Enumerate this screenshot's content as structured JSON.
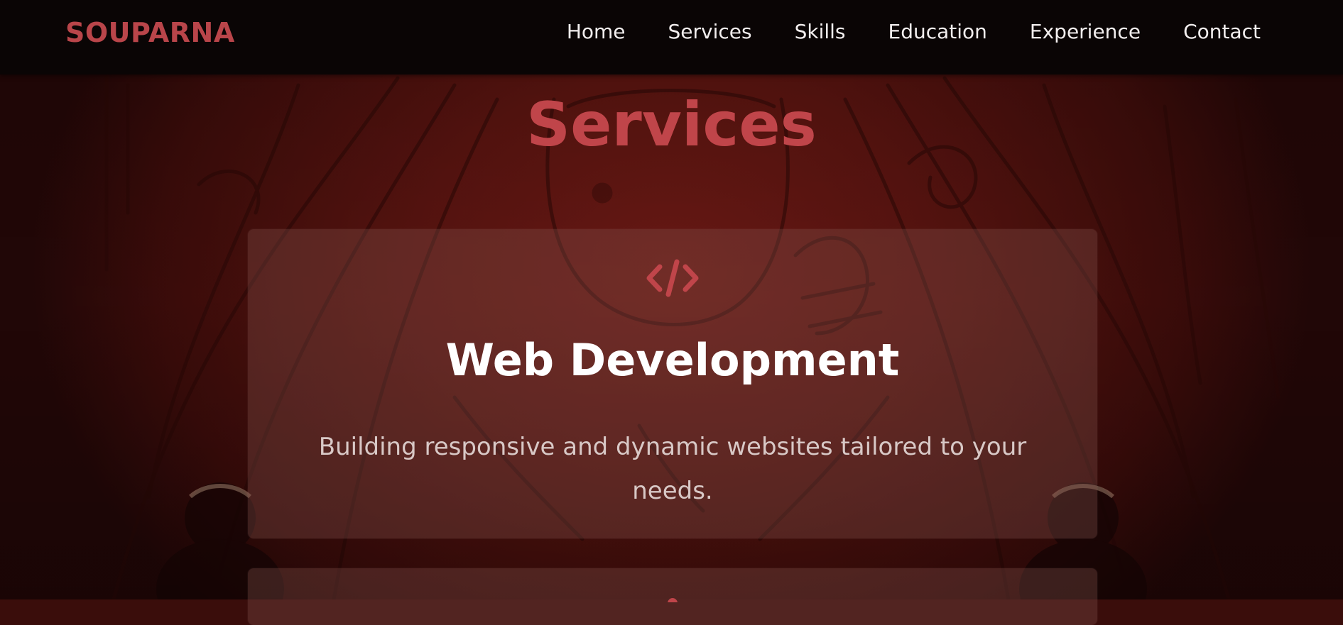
{
  "brand": {
    "name": "SOUPARNA"
  },
  "nav": {
    "links": [
      {
        "label": "Home"
      },
      {
        "label": "Services"
      },
      {
        "label": "Skills"
      },
      {
        "label": "Education"
      },
      {
        "label": "Experience"
      },
      {
        "label": "Contact"
      }
    ]
  },
  "services": {
    "title": "Services",
    "cards": [
      {
        "icon": "code-icon",
        "title": "Web Development",
        "description": "Building responsive and dynamic websites tailored to your needs."
      },
      {
        "icon": "service-icon"
      }
    ]
  },
  "colors": {
    "accent": "#c0454a",
    "nav_bg": "#0a0505",
    "card_bg": "rgba(135,85,80,0.33)",
    "text_light": "#ffffff"
  }
}
